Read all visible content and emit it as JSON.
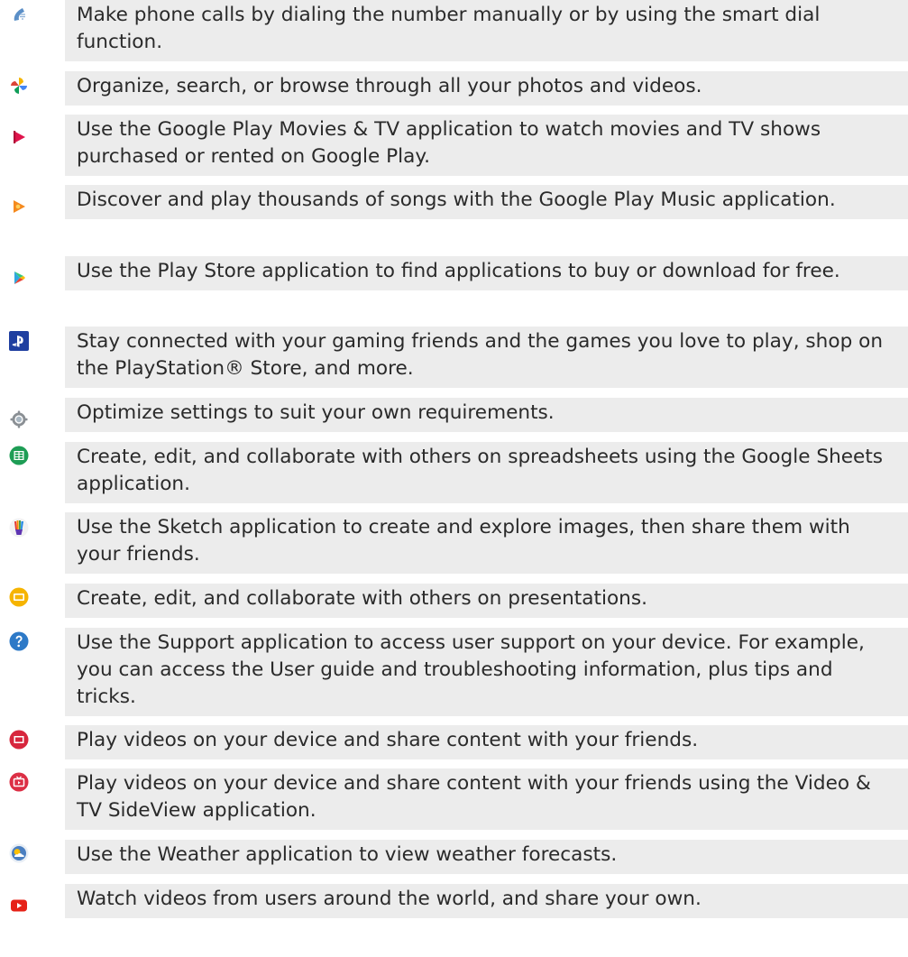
{
  "apps": [
    {
      "icon": "phone-icon",
      "description": "Make phone calls by dialing the number manually or by using the smart dial function."
    },
    {
      "icon": "photos-pinwheel-icon",
      "description": "Organize, search, or browse through all your photos and videos."
    },
    {
      "icon": "play-movies-icon",
      "description": "Use the Google Play Movies & TV application to watch movies and TV shows purchased or rented on Google Play."
    },
    {
      "icon": "play-music-icon",
      "description": "Discover and play thousands of songs with the Google Play Music application."
    },
    {
      "icon": "play-store-icon",
      "description": "Use the Play Store application to find applications to buy or download for free."
    },
    {
      "icon": "playstation-icon",
      "description": "Stay connected with your gaming friends and the games you love to play, shop on the PlayStation® Store, and more."
    },
    {
      "icon": "settings-gear-icon",
      "description": "Optimize settings to suit your own requirements."
    },
    {
      "icon": "sheets-icon",
      "description": "Create, edit, and collaborate with others on spreadsheets using the Google Sheets application."
    },
    {
      "icon": "sketch-icon",
      "description": "Use the Sketch application to create and explore images, then share them with your friends."
    },
    {
      "icon": "slides-icon",
      "description": "Create, edit, and collaborate with others on presentations."
    },
    {
      "icon": "support-question-icon",
      "description": "Use the Support application to access user support on your device. For example, you can access the User guide and troubleshooting information, plus tips and tricks."
    },
    {
      "icon": "video-icon",
      "description": "Play videos on your device and share content with your friends."
    },
    {
      "icon": "sideview-tv-icon",
      "description": "Play videos on your device and share content with your friends using the Video & TV SideView application."
    },
    {
      "icon": "weather-icon",
      "description": "Use the Weather application to view weather forecasts."
    },
    {
      "icon": "youtube-icon",
      "description": "Watch videos from users around the world, and share your own."
    }
  ],
  "colors": {
    "row_background": "#ececec",
    "text": "#2a2a2a",
    "phone": "#5b8fc7",
    "play_movies": "#e0144c",
    "play_music": "#f58a1e",
    "play_store": "#2fa8e0",
    "playstation": "#1f3fa0",
    "settings": "#8a8f94",
    "sheets": "#1e9d55",
    "slides": "#f6b400",
    "support": "#2d79c7",
    "video": "#d7263d",
    "youtube": "#e62117"
  }
}
